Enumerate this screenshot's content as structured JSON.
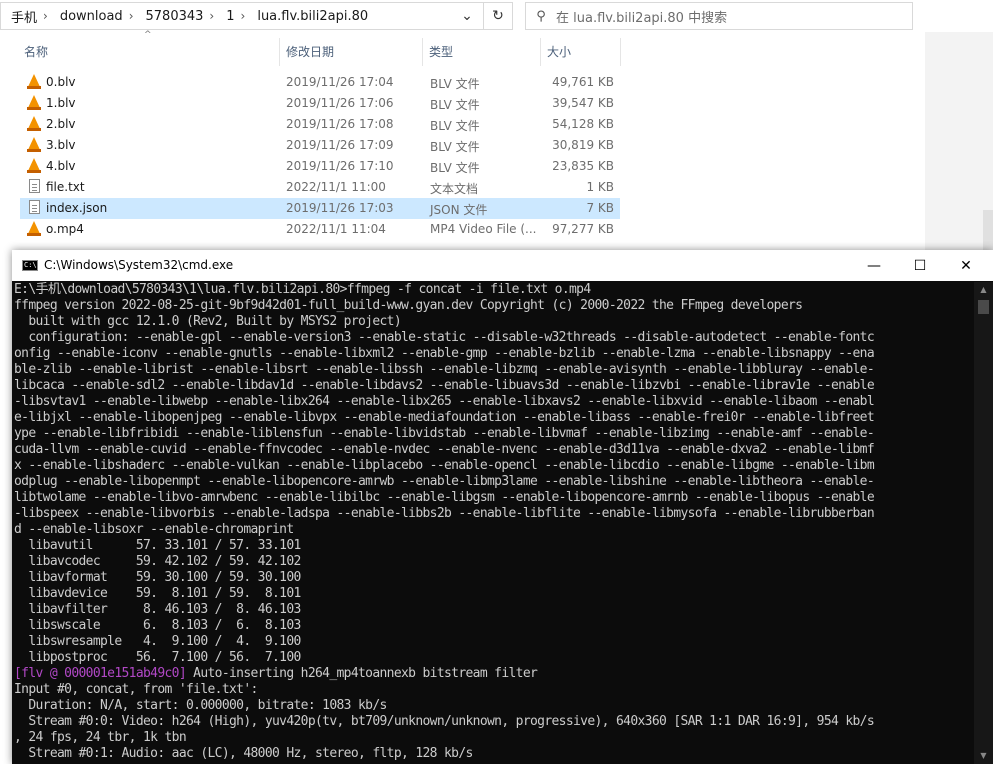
{
  "explorer": {
    "breadcrumb": [
      "手机",
      "download",
      "5780343",
      "1",
      "lua.flv.bili2api.80"
    ],
    "search_placeholder": "在 lua.flv.bili2api.80 中搜索",
    "columns": {
      "name": "名称",
      "date": "修改日期",
      "type": "类型",
      "size": "大小"
    },
    "files": [
      {
        "name": "0.blv",
        "date": "2019/11/26 17:04",
        "type": "BLV 文件",
        "size": "49,761 KB",
        "icon": "vlc-cone-icon"
      },
      {
        "name": "1.blv",
        "date": "2019/11/26 17:06",
        "type": "BLV 文件",
        "size": "39,547 KB",
        "icon": "vlc-cone-icon"
      },
      {
        "name": "2.blv",
        "date": "2019/11/26 17:08",
        "type": "BLV 文件",
        "size": "54,128 KB",
        "icon": "vlc-cone-icon"
      },
      {
        "name": "3.blv",
        "date": "2019/11/26 17:09",
        "type": "BLV 文件",
        "size": "30,819 KB",
        "icon": "vlc-cone-icon"
      },
      {
        "name": "4.blv",
        "date": "2019/11/26 17:10",
        "type": "BLV 文件",
        "size": "23,835 KB",
        "icon": "vlc-cone-icon"
      },
      {
        "name": "file.txt",
        "date": "2022/11/1 11:00",
        "type": "文本文档",
        "size": "1 KB",
        "icon": "text-file-icon"
      },
      {
        "name": "index.json",
        "date": "2019/11/26 17:03",
        "type": "JSON 文件",
        "size": "7 KB",
        "icon": "text-file-icon",
        "selected": true
      },
      {
        "name": "o.mp4",
        "date": "2022/11/1 11:04",
        "type": "MP4 Video File (...",
        "size": "97,277 KB",
        "icon": "vlc-cone-icon"
      }
    ]
  },
  "cmd": {
    "title": "C:\\Windows\\System32\\cmd.exe",
    "lines": [
      "E:\\手机\\download\\5780343\\1\\lua.flv.bili2api.80>ffmpeg -f concat -i file.txt o.mp4",
      "ffmpeg version 2022-08-25-git-9bf9d42d01-full_build-www.gyan.dev Copyright (c) 2000-2022 the FFmpeg developers",
      "  built with gcc 12.1.0 (Rev2, Built by MSYS2 project)",
      "  configuration: --enable-gpl --enable-version3 --enable-static --disable-w32threads --disable-autodetect --enable-fontc",
      "onfig --enable-iconv --enable-gnutls --enable-libxml2 --enable-gmp --enable-bzlib --enable-lzma --enable-libsnappy --ena",
      "ble-zlib --enable-librist --enable-libsrt --enable-libssh --enable-libzmq --enable-avisynth --enable-libbluray --enable-",
      "libcaca --enable-sdl2 --enable-libdav1d --enable-libdavs2 --enable-libuavs3d --enable-libzvbi --enable-librav1e --enable",
      "-libsvtav1 --enable-libwebp --enable-libx264 --enable-libx265 --enable-libxavs2 --enable-libxvid --enable-libaom --enabl",
      "e-libjxl --enable-libopenjpeg --enable-libvpx --enable-mediafoundation --enable-libass --enable-frei0r --enable-libfreet",
      "ype --enable-libfribidi --enable-liblensfun --enable-libvidstab --enable-libvmaf --enable-libzimg --enable-amf --enable-",
      "cuda-llvm --enable-cuvid --enable-ffnvcodec --enable-nvdec --enable-nvenc --enable-d3d11va --enable-dxva2 --enable-libmf",
      "x --enable-libshaderc --enable-vulkan --enable-libplacebo --enable-opencl --enable-libcdio --enable-libgme --enable-libm",
      "odplug --enable-libopenmpt --enable-libopencore-amrwb --enable-libmp3lame --enable-libshine --enable-libtheora --enable-",
      "libtwolame --enable-libvo-amrwbenc --enable-libilbc --enable-libgsm --enable-libopencore-amrnb --enable-libopus --enable",
      "-libspeex --enable-libvorbis --enable-ladspa --enable-libbs2b --enable-libflite --enable-libmysofa --enable-librubberban",
      "d --enable-libsoxr --enable-chromaprint",
      "  libavutil      57. 33.101 / 57. 33.101",
      "  libavcodec     59. 42.102 / 59. 42.102",
      "  libavformat    59. 30.100 / 59. 30.100",
      "  libavdevice    59.  8.101 / 59.  8.101",
      "  libavfilter     8. 46.103 /  8. 46.103",
      "  libswscale      6.  8.103 /  6.  8.103",
      "  libswresample   4.  9.100 /  4.  9.100",
      "  libpostproc    56.  7.100 / 56.  7.100",
      "[flv @ 000001e151ab49c0] Auto-inserting h264_mp4toannexb bitstream filter",
      "Input #0, concat, from 'file.txt':",
      "  Duration: N/A, start: 0.000000, bitrate: 1083 kb/s",
      "  Stream #0:0: Video: h264 (High), yuv420p(tv, bt709/unknown/unknown, progressive), 640x360 [SAR 1:1 DAR 16:9], 954 kb/s",
      ", 24 fps, 24 tbr, 1k tbn",
      "  Stream #0:1: Audio: aac (LC), 48000 Hz, stereo, fltp, 128 kb/s"
    ],
    "flv_tag": "[flv @ 000001e151ab49c0]",
    "flv_rest": " Auto-inserting h264_mp4toannexb bitstream filter",
    "colors": {
      "background": "#0c0c0c",
      "text": "#cccccc",
      "tag": "#b148c6"
    }
  }
}
